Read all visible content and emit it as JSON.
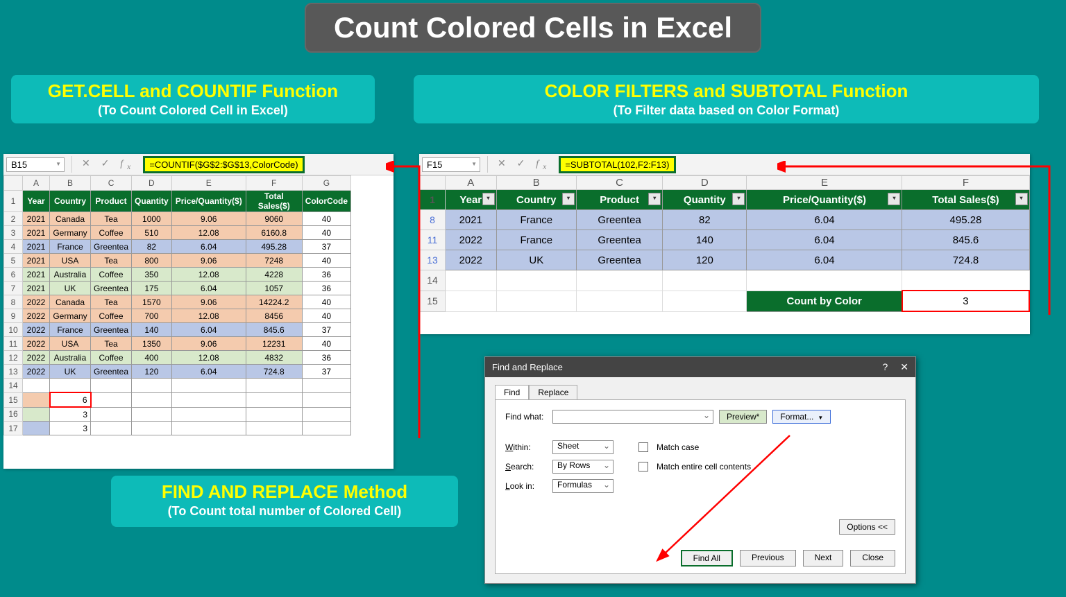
{
  "title": "Count Colored Cells in Excel",
  "panels": {
    "left": {
      "title": "GET.CELL and COUNTIF Function",
      "sub": "(To Count Colored Cell in Excel)"
    },
    "right": {
      "title": "COLOR FILTERS and SUBTOTAL Function",
      "sub": "(To Filter data based on Color Format)"
    },
    "bottom": {
      "title": "FIND AND REPLACE Method",
      "sub": "(To Count total number of Colored Cell)"
    }
  },
  "excel_left": {
    "namebox": "B15",
    "formula": "=COUNTIF($G$2:$G$13,ColorCode)",
    "cols": [
      "A",
      "B",
      "C",
      "D",
      "E",
      "F",
      "G"
    ],
    "headers": [
      "Year",
      "Country",
      "Product",
      "Quantity",
      "Price/Quantity($)",
      "Total Sales($)",
      "ColorCode"
    ],
    "rows": [
      {
        "n": 2,
        "c": "orange",
        "v": [
          "2021",
          "Canada",
          "Tea",
          "1000",
          "9.06",
          "9060",
          "40"
        ]
      },
      {
        "n": 3,
        "c": "orange",
        "v": [
          "2021",
          "Germany",
          "Coffee",
          "510",
          "12.08",
          "6160.8",
          "40"
        ]
      },
      {
        "n": 4,
        "c": "blue",
        "v": [
          "2021",
          "France",
          "Greentea",
          "82",
          "6.04",
          "495.28",
          "37"
        ]
      },
      {
        "n": 5,
        "c": "orange",
        "v": [
          "2021",
          "USA",
          "Tea",
          "800",
          "9.06",
          "7248",
          "40"
        ]
      },
      {
        "n": 6,
        "c": "green",
        "v": [
          "2021",
          "Australia",
          "Coffee",
          "350",
          "12.08",
          "4228",
          "36"
        ]
      },
      {
        "n": 7,
        "c": "green",
        "v": [
          "2021",
          "UK",
          "Greentea",
          "175",
          "6.04",
          "1057",
          "36"
        ]
      },
      {
        "n": 8,
        "c": "orange",
        "v": [
          "2022",
          "Canada",
          "Tea",
          "1570",
          "9.06",
          "14224.2",
          "40"
        ]
      },
      {
        "n": 9,
        "c": "orange",
        "v": [
          "2022",
          "Germany",
          "Coffee",
          "700",
          "12.08",
          "8456",
          "40"
        ]
      },
      {
        "n": 10,
        "c": "blue",
        "v": [
          "2022",
          "France",
          "Greentea",
          "140",
          "6.04",
          "845.6",
          "37"
        ]
      },
      {
        "n": 11,
        "c": "orange",
        "v": [
          "2022",
          "USA",
          "Tea",
          "1350",
          "9.06",
          "12231",
          "40"
        ]
      },
      {
        "n": 12,
        "c": "green",
        "v": [
          "2022",
          "Australia",
          "Coffee",
          "400",
          "12.08",
          "4832",
          "36"
        ]
      },
      {
        "n": 13,
        "c": "blue",
        "v": [
          "2022",
          "UK",
          "Greentea",
          "120",
          "6.04",
          "724.8",
          "37"
        ]
      }
    ],
    "results": {
      "r15a_color": "orange",
      "r15b": "6",
      "r16a_color": "green",
      "r16b": "3",
      "r17a_color": "blue",
      "r17b": "3"
    }
  },
  "excel_right": {
    "namebox": "F15",
    "formula": "=SUBTOTAL(102,F2:F13)",
    "cols": [
      "A",
      "B",
      "C",
      "D",
      "E",
      "F"
    ],
    "headers": [
      "Year",
      "Country",
      "Product",
      "Quantity",
      "Price/Quantity($)",
      "Total Sales($)"
    ],
    "rows": [
      {
        "n": 8,
        "v": [
          "2021",
          "France",
          "Greentea",
          "82",
          "6.04",
          "495.28"
        ]
      },
      {
        "n": 11,
        "v": [
          "2022",
          "France",
          "Greentea",
          "140",
          "6.04",
          "845.6"
        ]
      },
      {
        "n": 13,
        "v": [
          "2022",
          "UK",
          "Greentea",
          "120",
          "6.04",
          "724.8"
        ]
      }
    ],
    "count_label": "Count by Color",
    "count_value": "3"
  },
  "dialog": {
    "title": "Find and Replace",
    "tabs": [
      "Find",
      "Replace"
    ],
    "findwhat": "Find what:",
    "preview": "Preview*",
    "formatbtn": "Format...",
    "within_label": "Within:",
    "within": "Sheet",
    "search_label": "Search:",
    "search": "By Rows",
    "lookin_label": "Look in:",
    "lookin": "Formulas",
    "matchcase": "Match case",
    "matchcontents": "Match entire cell contents",
    "options": "Options <<",
    "buttons": {
      "findall": "Find All",
      "previous": "Previous",
      "next": "Next",
      "close": "Close"
    }
  }
}
